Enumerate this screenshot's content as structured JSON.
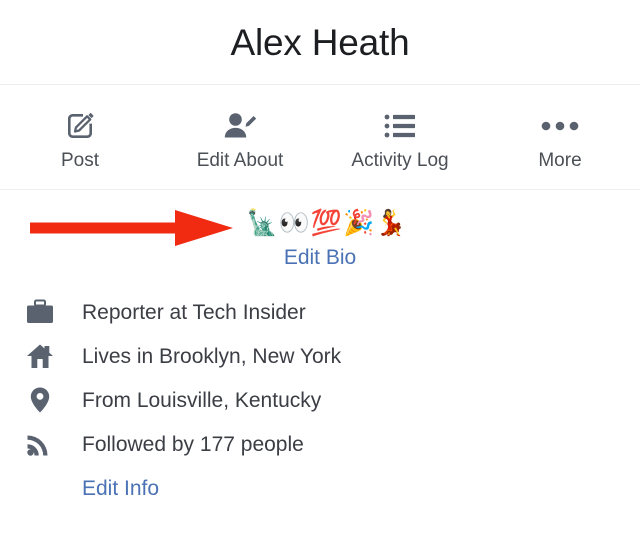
{
  "header": {
    "title": "Alex Heath"
  },
  "action_bar": {
    "items": [
      {
        "label": "Post",
        "icon": "compose-pencil-square-icon"
      },
      {
        "label": "Edit About",
        "icon": "person-pencil-icon"
      },
      {
        "label": "Activity Log",
        "icon": "bulleted-list-icon"
      },
      {
        "label": "More",
        "icon": "ellipsis-horizontal-icon"
      }
    ]
  },
  "bio": {
    "emojis": "🗽👀💯🎉💃",
    "edit_bio_label": "Edit Bio"
  },
  "annotation": {
    "type": "arrow",
    "direction": "right",
    "color": "#f02b11"
  },
  "info": {
    "rows": [
      {
        "icon": "briefcase-icon",
        "text": "Reporter at Tech Insider"
      },
      {
        "icon": "home-icon",
        "text": "Lives in Brooklyn, New York"
      },
      {
        "icon": "map-pin-icon",
        "text": "From Louisville, Kentucky"
      },
      {
        "icon": "rss-feed-icon",
        "text": "Followed by 177 people"
      }
    ],
    "edit_info_label": "Edit Info"
  },
  "colors": {
    "link": "#4a72b5",
    "icon_gray": "#5a6270",
    "text": "#3b3e44",
    "divider": "#eceef1",
    "annotation_red": "#f02b11"
  }
}
